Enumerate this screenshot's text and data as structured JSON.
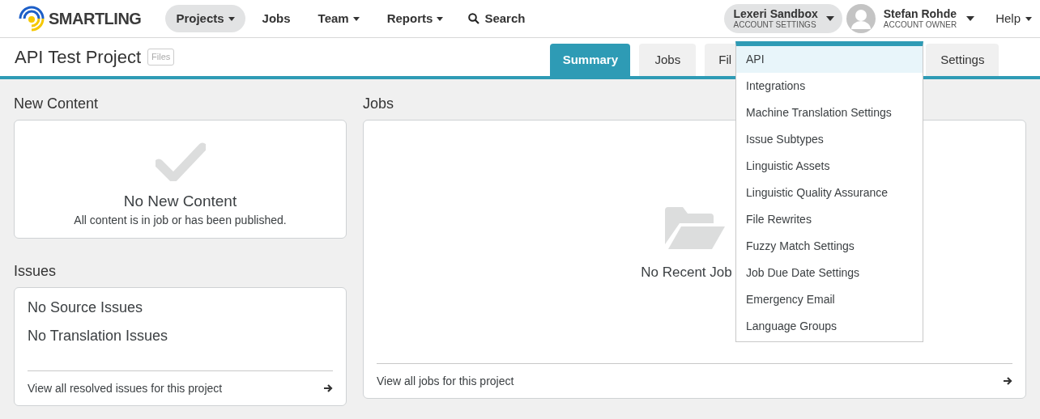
{
  "brand": "SMARTLING",
  "nav": [
    {
      "label": "Projects",
      "caret": true,
      "selected": true
    },
    {
      "label": "Jobs",
      "caret": false,
      "selected": false
    },
    {
      "label": "Team",
      "caret": true,
      "selected": false
    },
    {
      "label": "Reports",
      "caret": true,
      "selected": false
    }
  ],
  "search": {
    "label": "Search"
  },
  "account": {
    "name": "Lexeri Sandbox",
    "subtitle": "ACCOUNT SETTINGS"
  },
  "user": {
    "name": "Stefan Rohde",
    "role": "ACCOUNT OWNER"
  },
  "help": "Help",
  "project": {
    "title": "API Test Project",
    "badge": "Files"
  },
  "tabs": [
    {
      "label": "Summary",
      "selected": true
    },
    {
      "label": "Jobs",
      "selected": false
    },
    {
      "label": "Fil",
      "selected": false
    },
    {
      "label": "Settings",
      "selected": false
    }
  ],
  "new_content": {
    "heading": "New Content",
    "title": "No New Content",
    "message": "All content is in job or has been published."
  },
  "issues": {
    "heading": "Issues",
    "items": [
      "No Source Issues",
      "No Translation Issues"
    ],
    "link": "View all resolved issues for this project"
  },
  "jobs": {
    "heading": "Jobs",
    "empty": "No Recent Job",
    "link": "View all jobs for this project"
  },
  "account_menu": [
    {
      "label": "API",
      "selected": true
    },
    {
      "label": "Integrations",
      "selected": false
    },
    {
      "label": "Machine Translation Settings",
      "selected": false
    },
    {
      "label": "Issue Subtypes",
      "selected": false
    },
    {
      "label": "Linguistic Assets",
      "selected": false
    },
    {
      "label": "Linguistic Quality Assurance",
      "selected": false
    },
    {
      "label": "File Rewrites",
      "selected": false
    },
    {
      "label": "Fuzzy Match Settings",
      "selected": false
    },
    {
      "label": "Job Due Date Settings",
      "selected": false
    },
    {
      "label": "Emergency Email",
      "selected": false
    },
    {
      "label": "Language Groups",
      "selected": false
    }
  ]
}
